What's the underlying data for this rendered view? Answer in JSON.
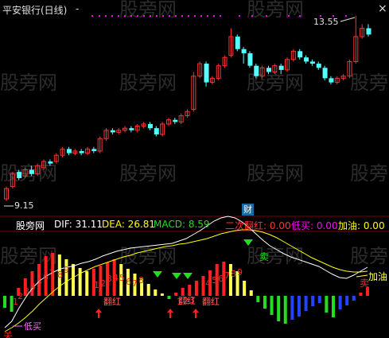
{
  "window": {
    "title": "平安银行(日线)",
    "minimize_label": "-",
    "close_label": "×"
  },
  "watermark": "股旁网",
  "price_labels": {
    "high": "13.55",
    "low": "9.15"
  },
  "badge_cai": "财",
  "indicator": {
    "name": "股旁网",
    "dif_label": "DIF: 31.11",
    "dea_label": "DEA: 26.81",
    "macd_label": "MACD: 8.59",
    "ercifanhong_label": "二次翻红: 0.00",
    "dimai_label": "低买: 0.00",
    "jiayou_label": "加油: 0.00"
  },
  "annotations": {
    "dimai": "低买",
    "fanhong": "翻红",
    "jiayou": "加油",
    "sell": "卖"
  },
  "colors": {
    "up": "#ff3232",
    "down": "#54ffff",
    "dif": "#ffffff",
    "dea": "#ffff00",
    "bar_red": "#ff2020",
    "bar_yellow": "#ffff55",
    "bar_green": "#22dd22",
    "bar_blue": "#2244ff",
    "dot": "#ff00ff",
    "dif_text": "#ffffff",
    "dea_text": "#ffff00",
    "macd_text": "#22dd22",
    "erci_text": "#ff3232",
    "dimai_text": "#ff00ff",
    "jiayou_text": "#ffff00"
  },
  "chart_data": {
    "type": "candlestick",
    "price_high_label": 13.55,
    "price_low_label": 9.15,
    "candles": [
      {
        "o": 9.15,
        "c": 9.4,
        "h": 9.45,
        "l": 9.1
      },
      {
        "o": 9.45,
        "c": 9.75,
        "h": 9.8,
        "l": 9.4
      },
      {
        "o": 9.8,
        "c": 9.65,
        "h": 9.85,
        "l": 9.6
      },
      {
        "o": 9.7,
        "c": 9.85,
        "h": 9.9,
        "l": 9.65
      },
      {
        "o": 9.85,
        "c": 9.75,
        "h": 9.95,
        "l": 9.7
      },
      {
        "o": 9.75,
        "c": 9.95,
        "h": 10.0,
        "l": 9.7
      },
      {
        "o": 9.9,
        "c": 10.05,
        "h": 10.1,
        "l": 9.85
      },
      {
        "o": 10.05,
        "c": 10.0,
        "h": 10.1,
        "l": 9.95
      },
      {
        "o": 10.05,
        "c": 10.2,
        "h": 10.25,
        "l": 10.0
      },
      {
        "o": 10.2,
        "c": 10.35,
        "h": 10.4,
        "l": 10.15
      },
      {
        "o": 10.35,
        "c": 10.25,
        "h": 10.4,
        "l": 10.2
      },
      {
        "o": 10.25,
        "c": 10.3,
        "h": 10.35,
        "l": 10.2
      },
      {
        "o": 10.3,
        "c": 10.25,
        "h": 10.35,
        "l": 10.2
      },
      {
        "o": 10.25,
        "c": 10.35,
        "h": 10.4,
        "l": 10.2
      },
      {
        "o": 10.35,
        "c": 10.3,
        "h": 10.4,
        "l": 10.25
      },
      {
        "o": 10.3,
        "c": 10.6,
        "h": 10.65,
        "l": 10.25
      },
      {
        "o": 10.6,
        "c": 10.8,
        "h": 10.85,
        "l": 10.55
      },
      {
        "o": 10.8,
        "c": 10.75,
        "h": 10.85,
        "l": 10.7
      },
      {
        "o": 10.75,
        "c": 10.8,
        "h": 10.85,
        "l": 10.7
      },
      {
        "o": 10.8,
        "c": 10.85,
        "h": 10.9,
        "l": 10.75
      },
      {
        "o": 10.85,
        "c": 10.8,
        "h": 10.9,
        "l": 10.75
      },
      {
        "o": 10.8,
        "c": 10.9,
        "h": 10.95,
        "l": 10.75
      },
      {
        "o": 10.9,
        "c": 10.95,
        "h": 11.0,
        "l": 10.85
      },
      {
        "o": 10.95,
        "c": 10.85,
        "h": 11.0,
        "l": 10.8
      },
      {
        "o": 10.85,
        "c": 10.7,
        "h": 10.9,
        "l": 10.65
      },
      {
        "o": 10.7,
        "c": 10.95,
        "h": 11.0,
        "l": 10.65
      },
      {
        "o": 10.95,
        "c": 11.05,
        "h": 11.1,
        "l": 10.9
      },
      {
        "o": 11.05,
        "c": 11.0,
        "h": 11.1,
        "l": 10.95
      },
      {
        "o": 11.0,
        "c": 11.15,
        "h": 11.2,
        "l": 10.95
      },
      {
        "o": 11.15,
        "c": 11.25,
        "h": 11.3,
        "l": 11.1
      },
      {
        "o": 11.3,
        "c": 12.1,
        "h": 12.2,
        "l": 11.25
      },
      {
        "o": 12.1,
        "c": 12.4,
        "h": 12.45,
        "l": 12.05
      },
      {
        "o": 12.4,
        "c": 11.95,
        "h": 12.45,
        "l": 11.85
      },
      {
        "o": 11.95,
        "c": 12.05,
        "h": 12.1,
        "l": 11.9
      },
      {
        "o": 12.05,
        "c": 12.35,
        "h": 12.4,
        "l": 12.0
      },
      {
        "o": 12.35,
        "c": 12.55,
        "h": 12.6,
        "l": 12.3
      },
      {
        "o": 12.6,
        "c": 13.05,
        "h": 13.25,
        "l": 12.55
      },
      {
        "o": 13.05,
        "c": 12.75,
        "h": 13.1,
        "l": 12.7
      },
      {
        "o": 12.75,
        "c": 12.65,
        "h": 12.8,
        "l": 12.4
      },
      {
        "o": 12.65,
        "c": 12.35,
        "h": 12.7,
        "l": 12.3
      },
      {
        "o": 12.35,
        "c": 12.1,
        "h": 12.4,
        "l": 12.05
      },
      {
        "o": 12.1,
        "c": 12.3,
        "h": 12.35,
        "l": 12.05
      },
      {
        "o": 12.3,
        "c": 12.2,
        "h": 12.35,
        "l": 12.15
      },
      {
        "o": 12.2,
        "c": 12.35,
        "h": 12.4,
        "l": 12.15
      },
      {
        "o": 12.35,
        "c": 12.25,
        "h": 12.4,
        "l": 12.15
      },
      {
        "o": 12.25,
        "c": 12.5,
        "h": 12.55,
        "l": 12.2
      },
      {
        "o": 12.5,
        "c": 12.7,
        "h": 12.75,
        "l": 12.45
      },
      {
        "o": 12.7,
        "c": 12.55,
        "h": 12.75,
        "l": 12.5
      },
      {
        "o": 12.55,
        "c": 12.45,
        "h": 12.6,
        "l": 12.4
      },
      {
        "o": 12.45,
        "c": 12.4,
        "h": 12.5,
        "l": 12.35
      },
      {
        "o": 12.4,
        "c": 12.3,
        "h": 12.45,
        "l": 12.25
      },
      {
        "o": 12.3,
        "c": 12.05,
        "h": 12.35,
        "l": 12.0
      },
      {
        "o": 12.05,
        "c": 11.95,
        "h": 12.1,
        "l": 11.9
      },
      {
        "o": 11.95,
        "c": 12.05,
        "h": 12.1,
        "l": 11.9
      },
      {
        "o": 12.05,
        "c": 12.1,
        "h": 12.15,
        "l": 12.0
      },
      {
        "o": 12.1,
        "c": 12.45,
        "h": 12.5,
        "l": 12.05
      },
      {
        "o": 12.45,
        "c": 13.05,
        "h": 13.55,
        "l": 12.4
      },
      {
        "o": 13.05,
        "c": 13.25,
        "h": 13.35,
        "l": 13.0
      },
      {
        "o": 13.25,
        "c": 13.1,
        "h": 13.35,
        "l": 13.05
      }
    ],
    "macd_bars": [
      -1.5,
      -2.0,
      1.0,
      2.2,
      3.1,
      4.0,
      5.0,
      5.4,
      5.2,
      4.6,
      4.0,
      3.5,
      3.1,
      3.4,
      3.8,
      4.2,
      4.6,
      4.0,
      3.4,
      2.8,
      2.2,
      1.5,
      0.8,
      0.3,
      -0.4,
      0.4,
      1.0,
      1.4,
      1.9,
      2.5,
      3.2,
      4.0,
      4.3,
      4.0,
      3.1,
      1.9,
      0.7,
      -0.8,
      -1.6,
      -2.4,
      -3.2,
      -3.5,
      -3.0,
      -2.6,
      -1.9,
      -1.3,
      -0.9,
      -2.1,
      -2.7,
      -1.7,
      -1.2,
      -0.6,
      0.4,
      1.1
    ],
    "dif": [
      -4.0,
      -3.2,
      -1.6,
      -0.2,
      1.0,
      1.9,
      2.5,
      3.0,
      3.4,
      3.6,
      3.8,
      4.1,
      4.3,
      4.6,
      5.0,
      5.3,
      5.6,
      5.8,
      6.0,
      6.1,
      6.2,
      6.3,
      6.4,
      6.5,
      6.6,
      6.9,
      7.2,
      7.7,
      8.2,
      8.8,
      9.4,
      9.8,
      10.0,
      9.8,
      9.3,
      8.6,
      7.8,
      7.0,
      6.3,
      5.8,
      5.3,
      4.9,
      4.6,
      4.3,
      4.0,
      3.7,
      3.2,
      2.7,
      2.3,
      2.2,
      2.6,
      3.1,
      3.6
    ],
    "dea": [
      -4.5,
      -4.0,
      -3.4,
      -2.7,
      -1.9,
      -1.0,
      -0.2,
      0.6,
      1.3,
      1.9,
      2.4,
      2.9,
      3.3,
      3.7,
      4.0,
      4.3,
      4.6,
      4.9,
      5.1,
      5.4,
      5.6,
      5.8,
      6.0,
      6.2,
      6.3,
      6.5,
      6.6,
      6.8,
      7.0,
      7.2,
      7.5,
      7.8,
      8.0,
      8.2,
      8.3,
      8.3,
      8.2,
      8.0,
      7.7,
      7.3,
      6.8,
      6.3,
      5.8,
      5.3,
      4.8,
      4.4,
      4.0,
      3.6,
      3.3,
      3.1,
      3.0,
      3.0,
      3.1
    ]
  }
}
